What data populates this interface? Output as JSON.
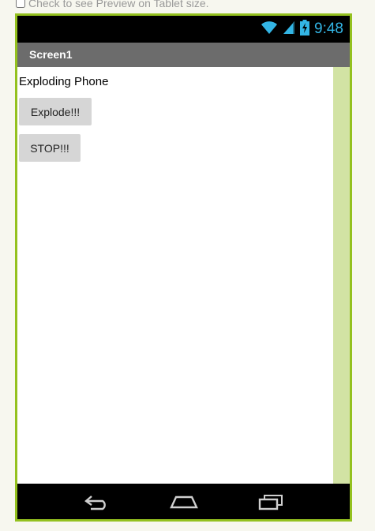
{
  "preview": {
    "checkbox_label": "Check to see Preview on Tablet size."
  },
  "status_bar": {
    "time": "9:48",
    "icons": [
      "wifi-icon",
      "signal-icon",
      "battery-charging-icon"
    ]
  },
  "screen": {
    "title": "Screen1",
    "label_text": "Exploding Phone",
    "buttons": {
      "explode": "Explode!!!",
      "stop": "STOP!!!"
    }
  },
  "nav_bar": {
    "icons": [
      "back-icon",
      "home-icon",
      "recents-icon"
    ]
  },
  "colors": {
    "frame_border": "#94c11f",
    "status_accent": "#33b5e5",
    "title_bar": "#6c6c6c",
    "scroll_strip": "#d2e3a4"
  }
}
